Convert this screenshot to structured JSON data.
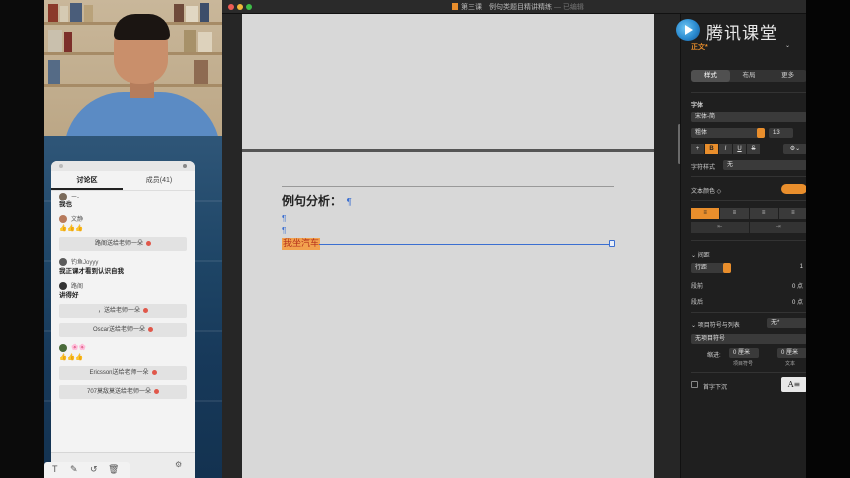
{
  "window": {
    "title": "第三课　例句类题目精讲精练",
    "status": "— 已编辑"
  },
  "logo": {
    "text": "腾讯课堂"
  },
  "chat": {
    "tabs": [
      {
        "label": "讨论区",
        "active": true
      },
      {
        "label": "成员(41)",
        "active": false
      }
    ],
    "top_user": "ー-",
    "messages": [
      {
        "user": "",
        "text": "我也"
      },
      {
        "user": "文静",
        "text": "👍👍👍"
      },
      {
        "gift": "路阁送给老师一朵"
      },
      {
        "user": "钓鱼Joyyy",
        "text": "我正课才看到认识自我"
      },
      {
        "user": "路阁",
        "text": "讲得好"
      },
      {
        "gift": "，送给老师一朵"
      },
      {
        "gift": "Oscar送给老师一朵"
      },
      {
        "user": "🌸🌸",
        "text": "👍👍👍"
      },
      {
        "gift": "Ericsson送给老师一朵"
      },
      {
        "gift": "707莫敌莫送给老师一朵"
      }
    ]
  },
  "document": {
    "heading": "例句分析：",
    "pilcrow": "¶",
    "selected_text": "我坐汽车"
  },
  "inspector": {
    "paragraph_style": "正文*",
    "tabs": [
      {
        "label": "样式",
        "active": true
      },
      {
        "label": "布局",
        "active": false
      },
      {
        "label": "更多",
        "active": false
      }
    ],
    "font_section": "字体",
    "font_family": "宋体-简",
    "font_weight": "粗体",
    "font_size": "13",
    "format_buttons": [
      "+",
      "B",
      "I",
      "U",
      "S"
    ],
    "char_style_label": "字符样式",
    "char_style_value": "无",
    "text_color_label": "文本颜色 ◇",
    "text_color": "#e98e2c",
    "align_buttons": [
      "≡",
      "≡",
      "≡",
      "≡"
    ],
    "indent_buttons": [
      "⇤",
      "⇥"
    ],
    "spacing": {
      "section": "间距",
      "line_mode": "行距",
      "line_value": "1",
      "before_label": "段前",
      "before_value": "0 点",
      "after_label": "段后",
      "after_value": "0 点"
    },
    "bullets": {
      "section": "项目符号与列表",
      "value": "无*",
      "list_type": "无项目符号",
      "indent_label": "缩进:",
      "bullet_indent": "0 厘米",
      "text_indent": "0 厘米",
      "bullet_caption": "项目符号",
      "text_caption": "文本"
    },
    "drop_cap_label": "首字下沉",
    "drop_cap_glyph": "A≡"
  },
  "annotation_tools": [
    "T",
    "✎",
    "↺",
    "🗑"
  ]
}
